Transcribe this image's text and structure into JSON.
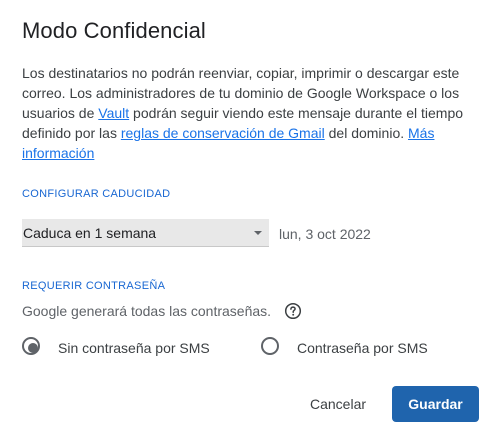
{
  "dialog": {
    "title": "Modo Confidencial",
    "description": {
      "part1": "Los destinatarios no podrán reenviar, copiar, imprimir o descargar este correo. Los administradores de tu dominio de Google Workspace o los usuarios de ",
      "link_vault": "Vault",
      "part2": " podrán seguir viendo este mensaje durante el tiempo definido por las ",
      "link_retention": "reglas de conservación de Gmail",
      "part3": " del dominio. ",
      "link_more": "Más información"
    },
    "expiry": {
      "section_label": "CONFIGURAR CADUCIDAD",
      "selected": "Caduca en 1 semana",
      "date": "lun, 3 oct 2022"
    },
    "password": {
      "section_label": "REQUERIR CONTRASEÑA",
      "note": "Google generará todas las contraseñas.",
      "options": [
        {
          "label": "Sin contraseña por SMS",
          "selected": true
        },
        {
          "label": "Contraseña por SMS",
          "selected": false
        }
      ]
    },
    "actions": {
      "cancel_label": "Cancelar",
      "save_label": "Guardar"
    }
  },
  "icons": {
    "help": "help-circle-icon",
    "dropdown": "caret-down-icon"
  },
  "colors": {
    "link": "#1a73e8",
    "section_label": "#1967d2",
    "primary_button": "#1f64ad",
    "select_background": "#e8e8e8"
  }
}
